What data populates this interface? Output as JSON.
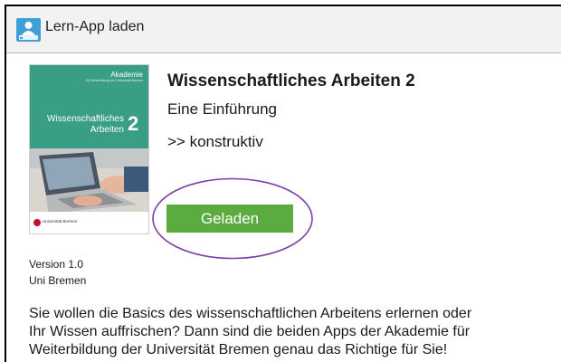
{
  "titlebar": {
    "icon": "app-store-icon",
    "title": "Lern-App laden"
  },
  "app": {
    "cover": {
      "logo_name": "Akademie",
      "logo_subtitle": "für Weiterbildung der Universität Bremen",
      "title_line1": "Wissenschaftliches",
      "title_line2": "Arbeiten",
      "number": "2",
      "footer": "Universität Bremen",
      "accent_color": "#3a9d86"
    },
    "title": "Wissenschaftliches Arbeiten 2",
    "subtitle": "Eine Einführung",
    "publisher": ">> konstruktiv",
    "install_button": {
      "label": "Geladen",
      "color": "#5aac3e"
    },
    "highlight_color": "#7b3fa8",
    "version": "Version 1.0",
    "developer": "Uni Bremen"
  },
  "description": {
    "lines": [
      "Sie wollen die Basics des wissenschaftlichen Arbeitens erlernen oder",
      "Ihr Wissen auffrischen? Dann sind die beiden Apps der Akademie für",
      "Weiterbildung der Universität Bremen genau das Richtige für Sie!"
    ]
  }
}
